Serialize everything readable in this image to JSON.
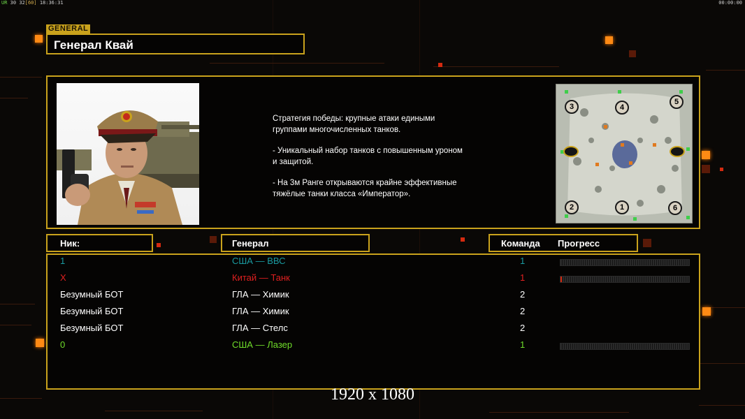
{
  "topbar": {
    "left_prefix": "UR",
    "fps_a": "30",
    "fps_b": "32",
    "fps_c": "[60]",
    "clock": "18:36:31",
    "right_clock": "00:00:00"
  },
  "general": {
    "tag": "GENERAL",
    "name": "Генерал Квай",
    "description": [
      "Стратегия победы: крупные атаки едиными\n группами многочисленных танков.",
      "- Уникальный набор танков с повышенным уроном\n и защитой.",
      "- На 3м Ранге открываются крайне эффективные\n тяжёлые танки класса «Император»."
    ]
  },
  "minimap": {
    "spawns": [
      "3",
      "4",
      "5",
      "2",
      "1",
      "6"
    ]
  },
  "table": {
    "headers": {
      "nick": "Ник:",
      "general": "Генерал",
      "team": "Команда",
      "progress": "Прогресс"
    },
    "rows": [
      {
        "nick": "1",
        "general": "США — ВВС",
        "team": "1",
        "color": "#1a9aa0",
        "progress": 0
      },
      {
        "nick": "X",
        "general": "Китай — Танк",
        "team": "1",
        "color": "#e02020",
        "progress": 0.01
      },
      {
        "nick": "Безумный БОТ",
        "general": "ГЛА — Химик",
        "team": "2",
        "color": "#ffffff"
      },
      {
        "nick": "Безумный БОТ",
        "general": "ГЛА — Химик",
        "team": "2",
        "color": "#ffffff"
      },
      {
        "nick": "Безумный БОТ",
        "general": "ГЛА — Стелс",
        "team": "2",
        "color": "#ffffff"
      },
      {
        "nick": "0",
        "general": "США — Лазер",
        "team": "1",
        "color": "#6fdc2a",
        "progress": 0
      }
    ]
  },
  "resolution": "1920 x 1080",
  "colors": {
    "frame": "#c9a21c",
    "accent": "#ff8a14"
  }
}
